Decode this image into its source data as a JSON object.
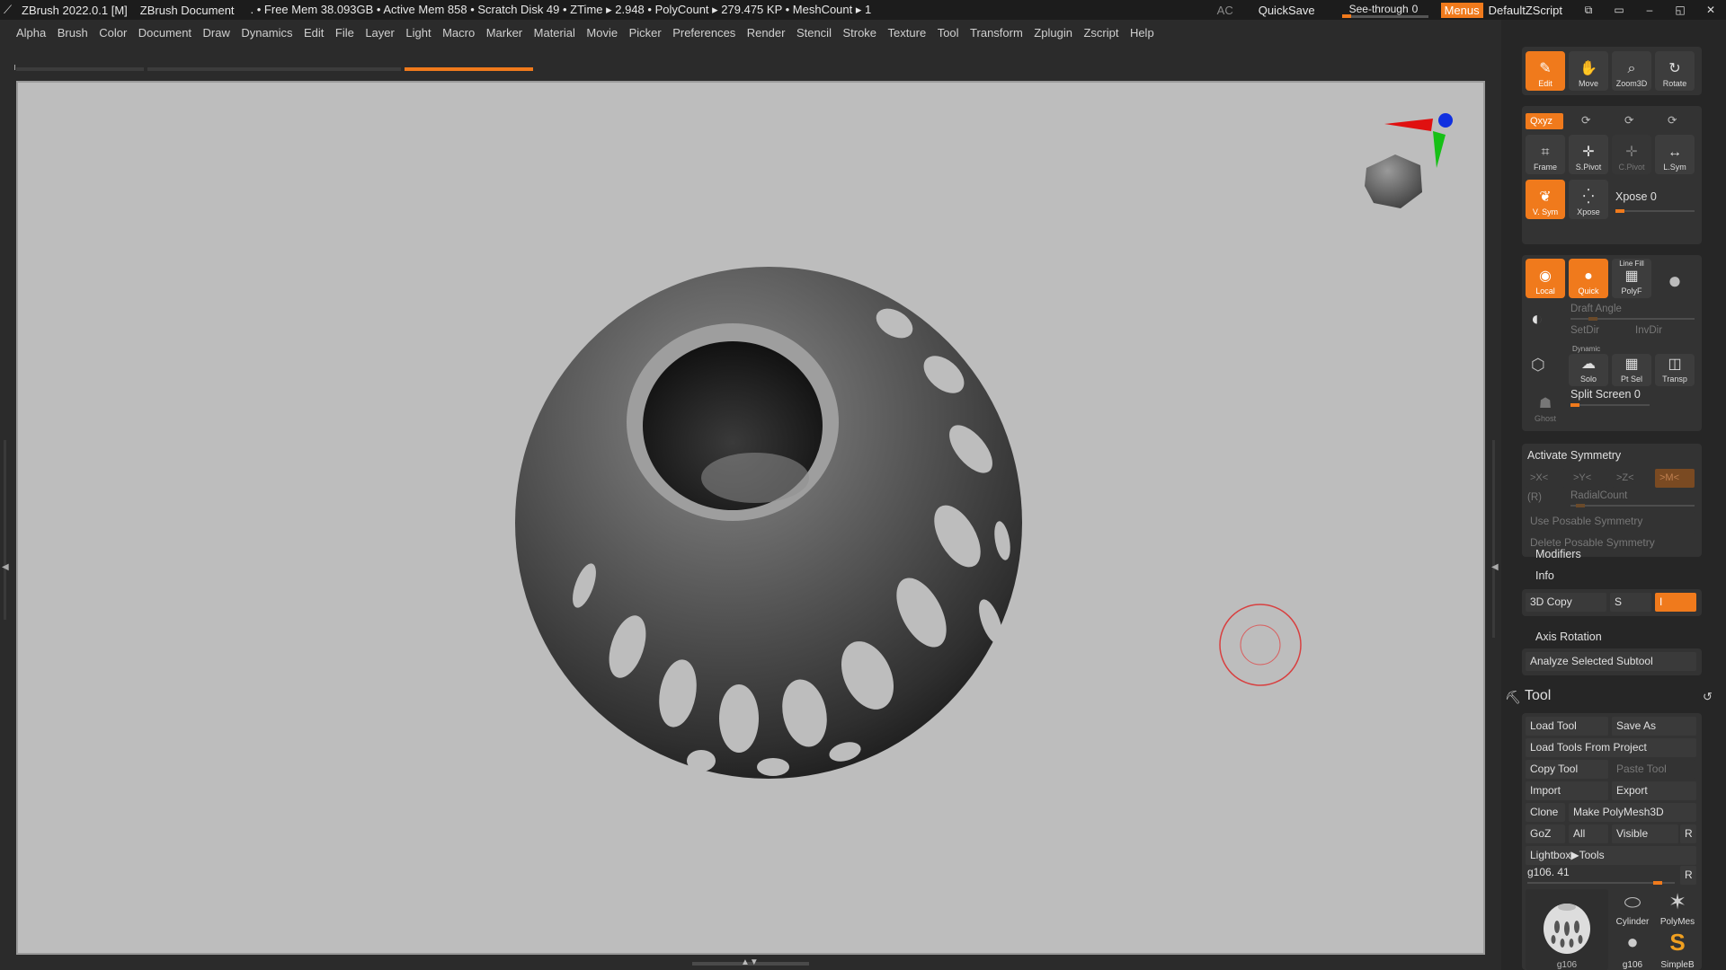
{
  "titlebar": {
    "app": "ZBrush 2022.0.1 [M]",
    "document": "ZBrush Document",
    "stats": ". • Free Mem 38.093GB • Active Mem 858 • Scratch Disk 49 •  ZTime ▸ 2.948 • PolyCount ▸ 279.475 KP  • MeshCount ▸ 1",
    "ac": "AC",
    "quicksave": "QuickSave",
    "seethrough_label": "See-through",
    "seethrough_value": "0",
    "menus": "Menus",
    "script": "DefaultZScript"
  },
  "menubar": [
    "Alpha",
    "Brush",
    "Color",
    "Document",
    "Draw",
    "Dynamics",
    "Edit",
    "File",
    "Layer",
    "Light",
    "Macro",
    "Marker",
    "Material",
    "Movie",
    "Picker",
    "Preferences",
    "Render",
    "Stencil",
    "Stroke",
    "Texture",
    "Tool",
    "Transform",
    "Zplugin",
    "Zscript",
    "Help"
  ],
  "nav": {
    "edit": "Edit",
    "move": "Move",
    "zoom3d": "Zoom3D",
    "rotate": "Rotate"
  },
  "view": {
    "xyz": "Qxyz",
    "frame": "Frame",
    "spivot": "S.Pivot",
    "cpivot": "C.Pivot",
    "lsym": "L.Sym",
    "vsym": "V. Sym",
    "xpose": "Xpose",
    "xpose_label": "Xpose 0"
  },
  "draw": {
    "local": "Local",
    "quick": "Quick",
    "linefill": "Line Fill",
    "polyf": "PolyF",
    "draft_angle": "Draft Angle",
    "setdir": "SetDir",
    "invdir": "InvDir",
    "dynamic": "Dynamic",
    "solo": "Solo",
    "ptsel": "Pt Sel",
    "transp": "Transp",
    "split_screen": "Split Screen 0",
    "ghost": "Ghost"
  },
  "symmetry": {
    "title": "Activate Symmetry",
    "x": ">X<",
    "y": ">Y<",
    "z": ">Z<",
    "m": ">M<",
    "r": "(R)",
    "radial": "RadialCount",
    "use_posable": "Use Posable Symmetry",
    "delete_posable": "Delete Posable Symmetry"
  },
  "sections": {
    "modifiers": "Modifiers",
    "info": "Info",
    "copy3d": "3D Copy",
    "copy3d_s": "S",
    "copy3d_i": "I",
    "axis_rotation": "Axis Rotation",
    "analyze": "Analyze Selected Subtool"
  },
  "tool": {
    "title": "Tool",
    "load": "Load Tool",
    "save_as": "Save As",
    "load_project": "Load Tools From Project",
    "copy": "Copy Tool",
    "paste": "Paste Tool",
    "import": "Import",
    "export": "Export",
    "clone": "Clone",
    "make_polymesh": "Make PolyMesh3D",
    "goz": "GoZ",
    "all": "All",
    "visible": "Visible",
    "r": "R",
    "lightbox": "Lightbox▶Tools",
    "current": "g106. 41",
    "r2": "R",
    "thumbs": [
      "Cylinder",
      "PolyMes",
      "g106",
      "SimpleB",
      "g106"
    ]
  },
  "colors": {
    "accent": "#f07a1c",
    "canvas": "#bdbdbd",
    "panel": "#262626"
  }
}
